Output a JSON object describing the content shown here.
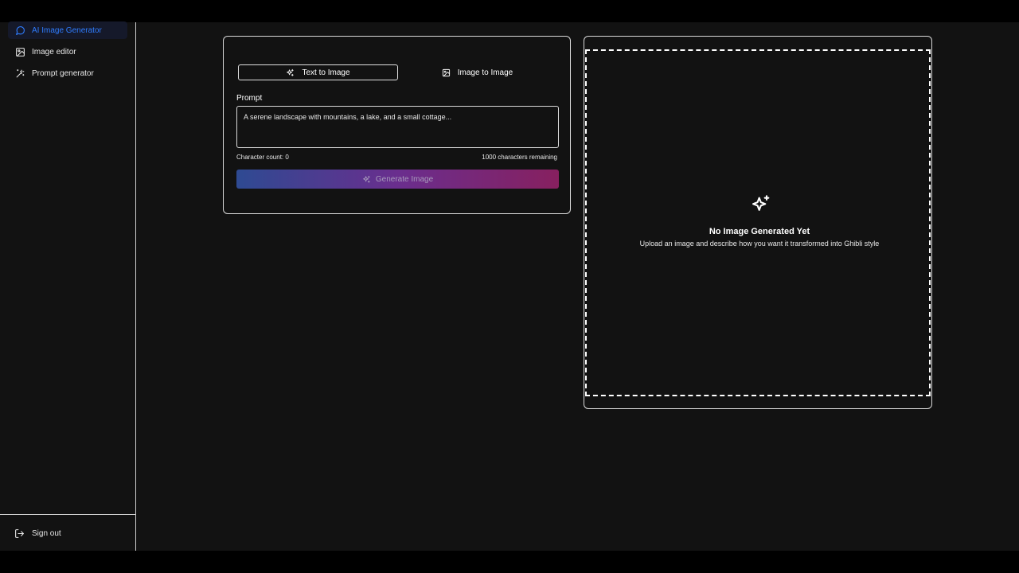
{
  "sidebar": {
    "items": [
      {
        "label": "AI Image Generator",
        "icon": "chat-bubble-icon",
        "active": true
      },
      {
        "label": "Image editor",
        "icon": "image-icon",
        "active": false
      },
      {
        "label": "Prompt generator",
        "icon": "magic-wand-icon",
        "active": false
      }
    ],
    "signout_label": "Sign out"
  },
  "generator": {
    "tabs": [
      {
        "label": "Text to Image",
        "icon": "sparkles-icon",
        "selected": true
      },
      {
        "label": "Image to Image",
        "icon": "image-icon",
        "selected": false
      }
    ],
    "prompt_label": "Prompt",
    "prompt_placeholder": "A serene landscape with mountains, a lake, and a small cottage...",
    "prompt_value": "",
    "char_count_text": "Character count: 0",
    "remaining_text": "1000 characters remaining",
    "generate_label": "Generate Image"
  },
  "output": {
    "empty_title": "No Image Generated Yet",
    "empty_subtitle": "Upload an image and describe how you want it transformed into Ghibli style"
  },
  "colors": {
    "background": "#121212",
    "accent": "#2f7dff",
    "gradient_start": "#2e4a92",
    "gradient_mid": "#6a2e8e",
    "gradient_end": "#87205f"
  }
}
